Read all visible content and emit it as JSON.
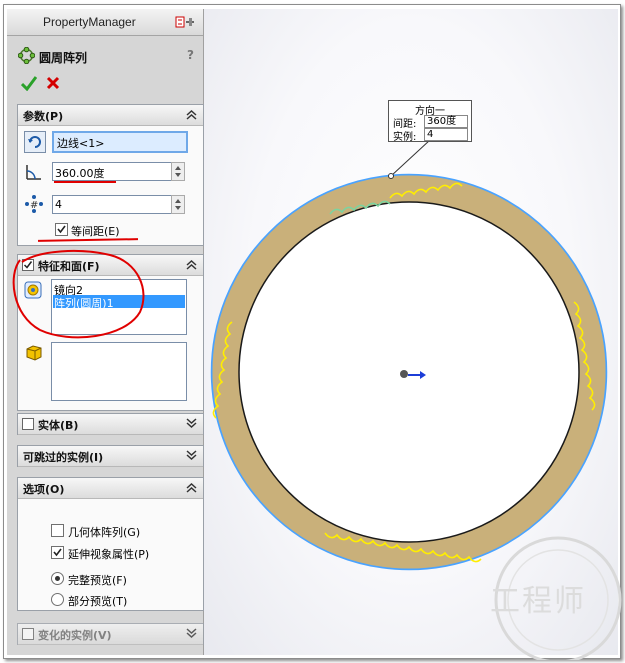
{
  "panel": {
    "title": "PropertyManager",
    "feature_name": "圆周阵列",
    "help_label": "?"
  },
  "params": {
    "header": "参数(P)",
    "edge_value": "边线<1>",
    "angle_value": "360.00度",
    "count_value": "4",
    "equal_spacing_label": "等间距(E)",
    "equal_spacing_checked": true
  },
  "features": {
    "header": "特征和面(F)",
    "checked": true,
    "items": [
      "镜向2",
      "阵列(圆周)1"
    ],
    "selected_index": 1
  },
  "bodies": {
    "header": "实体(B)"
  },
  "skip": {
    "header": "可跳过的实例(I)"
  },
  "options": {
    "header": "选项(O)",
    "geometry_pattern_label": "几何体阵列(G)",
    "propagate_label": "延伸视象属性(P)",
    "full_preview_label": "完整预览(F)",
    "partial_preview_label": "部分预览(T)"
  },
  "varied": {
    "header": "变化的实例(V)"
  },
  "callout": {
    "title": "方向一",
    "spacing_label": "间距:",
    "spacing_value": "360度",
    "instances_label": "实例:",
    "instances_value": "4"
  },
  "watermark": "工程师",
  "colors": {
    "ring": "#c9b07a",
    "ring_edge": "#4aa3ff",
    "teeth": "#ffee00",
    "annotation": "#e00000",
    "selection": "#3399ff"
  }
}
